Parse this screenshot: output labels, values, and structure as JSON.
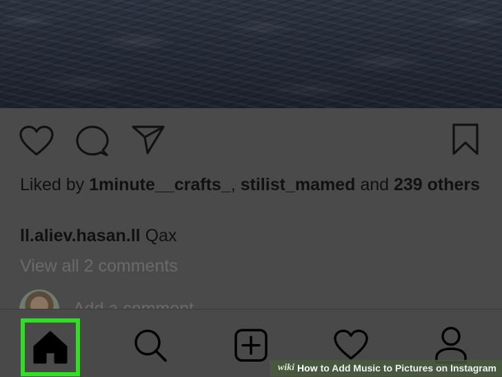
{
  "post": {
    "likes": {
      "prefix": "Liked by ",
      "user1": "1minute__crafts_",
      "separator": ", ",
      "user2": "stilist_mamed",
      "and": " and ",
      "others": "239 others"
    },
    "caption": {
      "username": "ll.aliev.hasan.ll",
      "text": " Qax"
    },
    "view_comments": "View all 2 comments",
    "add_comment_placeholder": "Add a comment..."
  },
  "actions": {
    "like_icon": "heart-icon",
    "comment_icon": "comment-icon",
    "share_icon": "paper-plane-icon",
    "save_icon": "bookmark-icon"
  },
  "navbar": {
    "items": [
      {
        "icon": "home-icon",
        "highlighted": true
      },
      {
        "icon": "search-icon"
      },
      {
        "icon": "add-post-icon"
      },
      {
        "icon": "heart-icon"
      },
      {
        "icon": "profile-icon"
      }
    ],
    "highlight_color": "#2ee01f"
  },
  "watermark": {
    "wiki": "wiki",
    "how": "How",
    "title": " to Add Music to Pictures on Instagram"
  }
}
